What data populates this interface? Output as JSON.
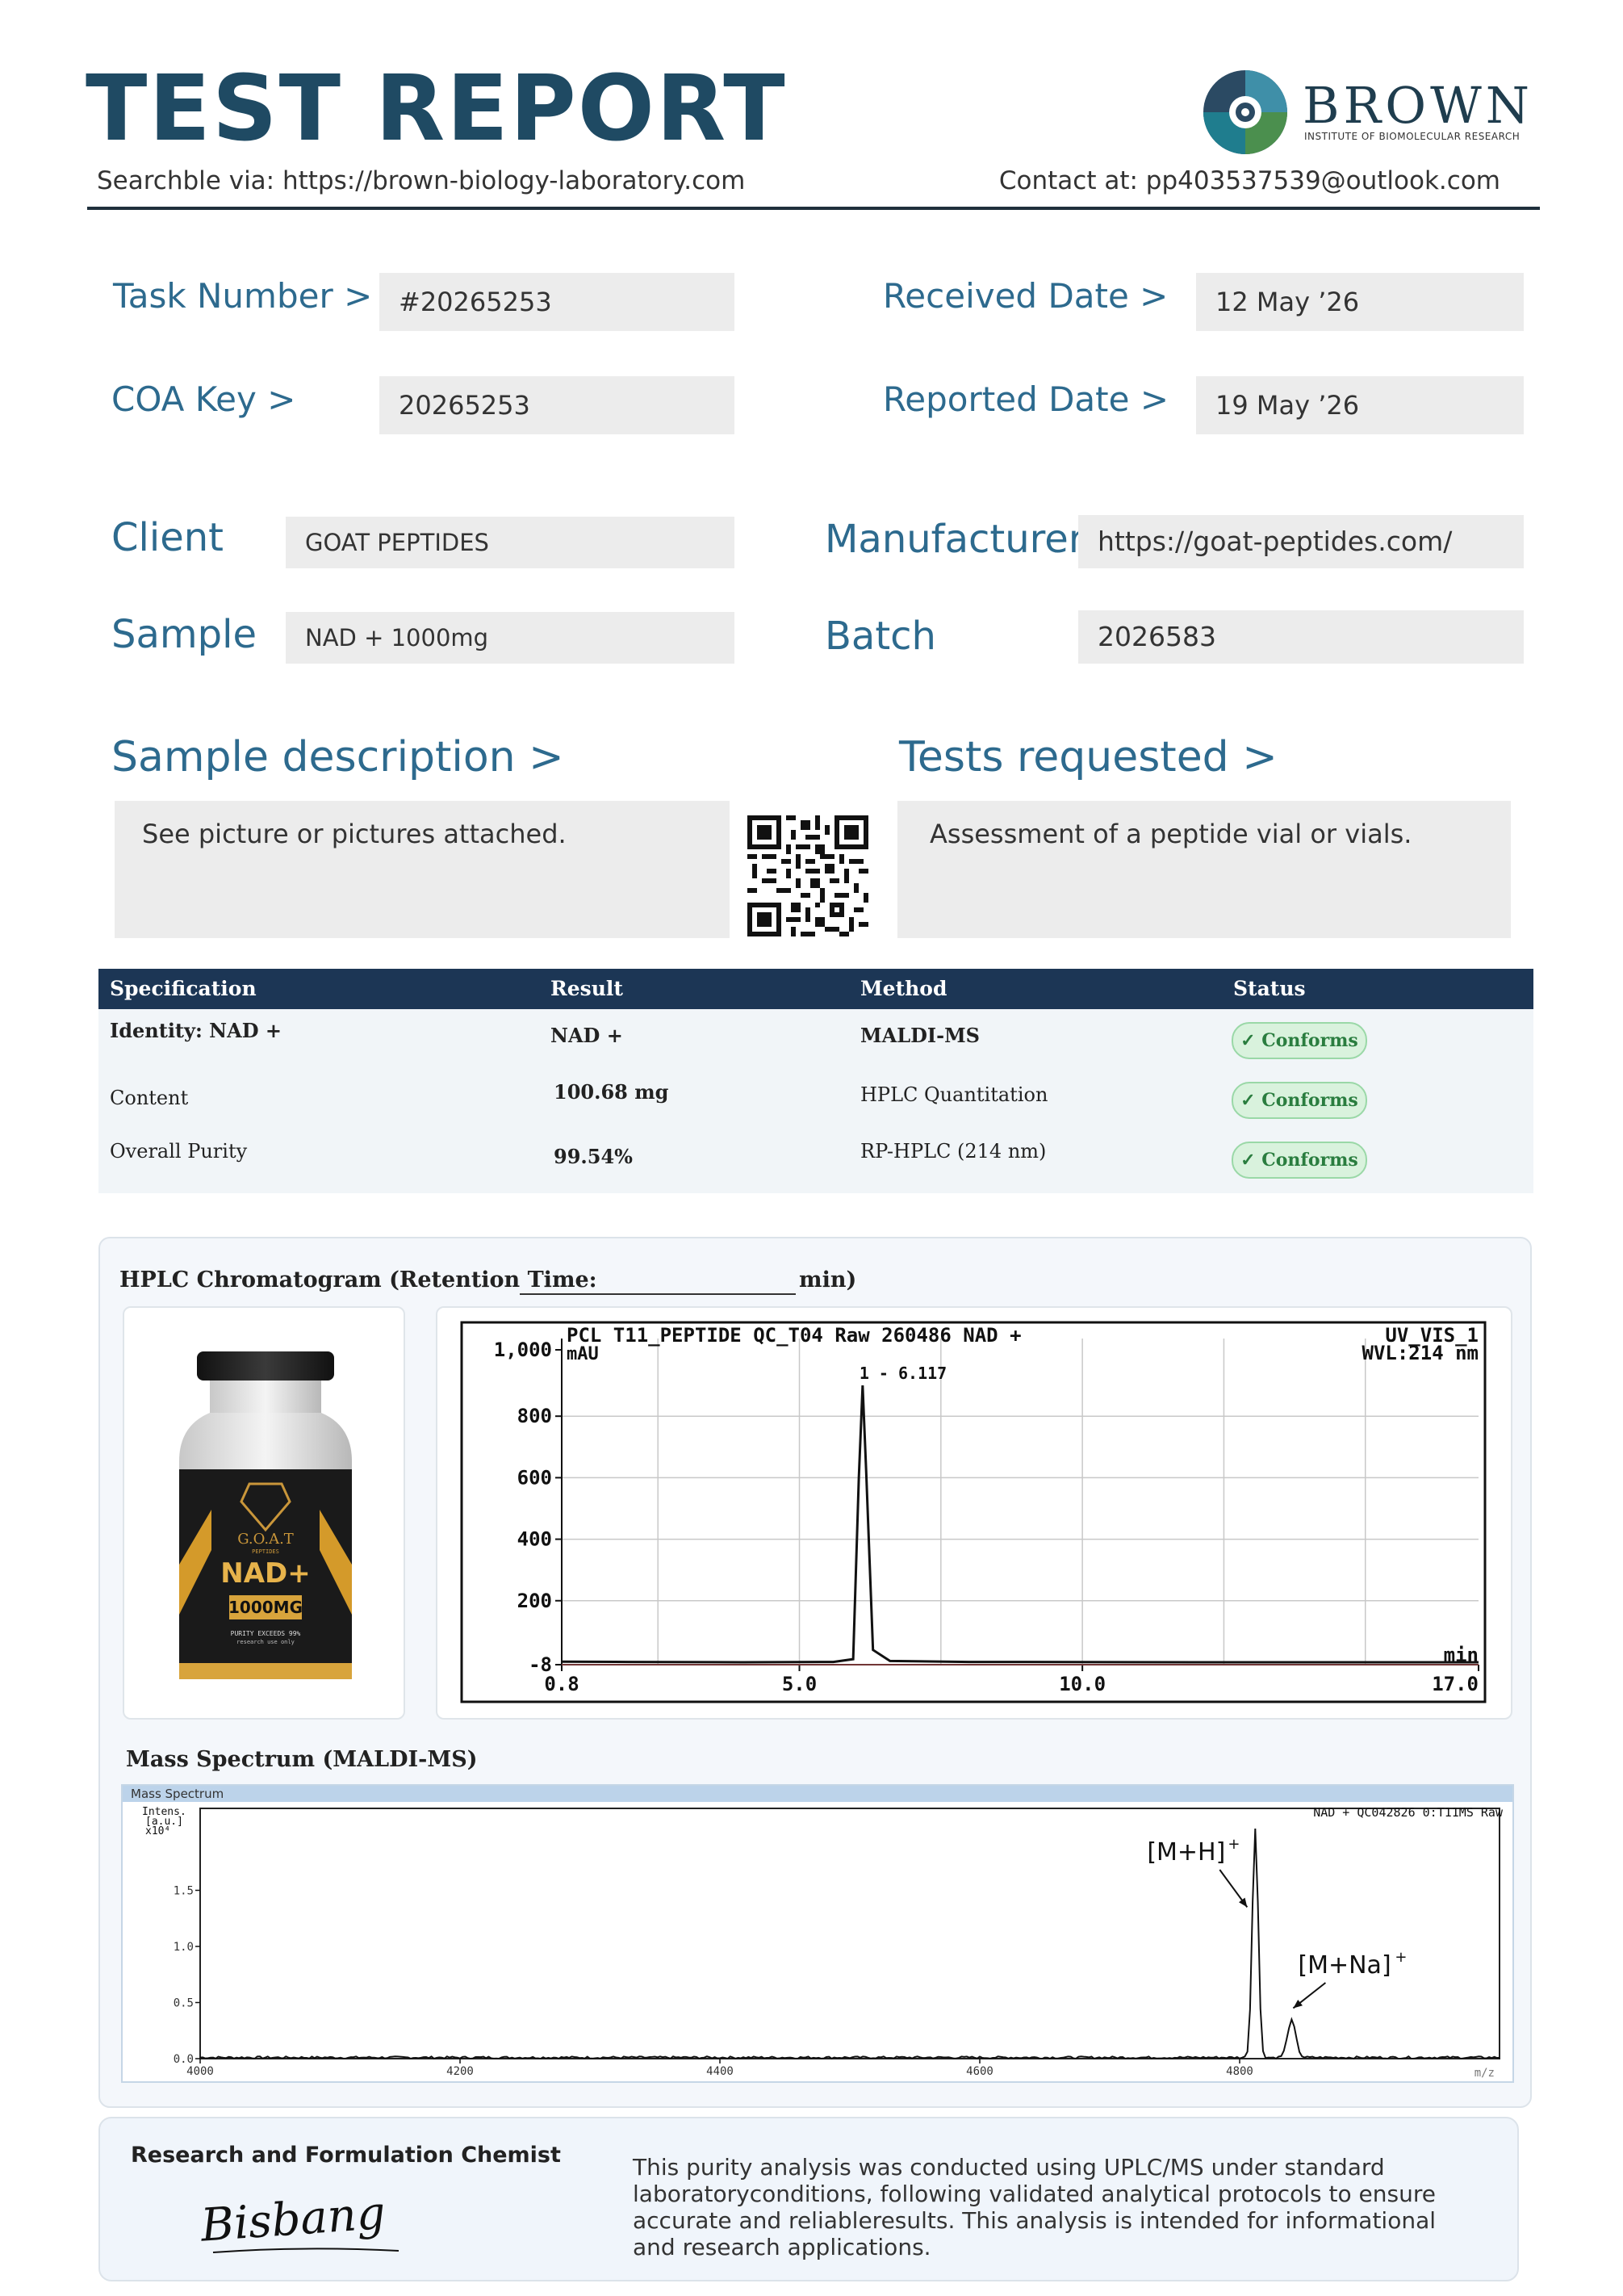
{
  "header": {
    "title": "TEST REPORT",
    "search_line": "Searchble via: https://brown-biology-laboratory.com",
    "contact_line": "Contact at: pp403537539@outlook.com",
    "logo_word": "BROWN",
    "logo_sub": "INSTITUTE OF BIOMOLECULAR RESEARCH"
  },
  "info": {
    "task_label": "Task Number  >",
    "task_value": "#20265253",
    "coa_label": "COA  Key >",
    "coa_value": "20265253",
    "received_label": "Received Date  >",
    "received_value": "12 May ’26",
    "reported_label": "Reported Date >",
    "reported_value": "19 May ’26",
    "client_label": "Client",
    "client_value": "GOAT PEPTIDES",
    "manufacturer_label": "Manufacturer",
    "manufacturer_value": "https://goat-peptides.com/",
    "sample_label": "Sample",
    "sample_value": "NAD + 1000mg",
    "batch_label": "Batch",
    "batch_value": "2026583"
  },
  "description": {
    "sample_desc_label": "Sample description   >",
    "sample_desc_text": "See picture or pictures attached.",
    "tests_label": "Tests requested   >",
    "tests_text": "Assessment of a peptide vial or vials."
  },
  "spec_table": {
    "headers": [
      "Specification",
      "Result",
      "Method",
      "Status"
    ],
    "rows": [
      {
        "spec": "Identity: NAD +",
        "result": "NAD +",
        "method": "MALDI-MS",
        "status": "✓ Conforms"
      },
      {
        "spec": "Content",
        "result": "100.68 mg",
        "method": "HPLC Quantitation",
        "status": "✓ Conforms"
      },
      {
        "spec": "Overall Purity",
        "result": "99.54%",
        "method": "RP-HPLC (214 nm)",
        "status": "✓ Conforms"
      }
    ]
  },
  "charts": {
    "hplc_title": "HPLC Chromatogram (Retention Time:",
    "hplc_title_suffix": "min)",
    "ms_title": "Mass Spectrum (MALDI-MS)",
    "ms_card_title": "Mass Spectrum"
  },
  "vial": {
    "brand": "G.O.A.T",
    "brand_sub": "PEPTIDES",
    "product": "NAD+",
    "dose": "1000MG",
    "note": "PURITY EXCEEDS 99%",
    "note2": "research use only"
  },
  "chart_data": [
    {
      "type": "line",
      "title": "PCL T11_PEPTIDE QC_T04 Raw 260486 NAD +",
      "channel": "UV_VIS_1",
      "wavelength": "WVL:214 nm",
      "ylabel": "mAU",
      "xlabel": "min",
      "ylim": [
        -8,
        1000
      ],
      "xlim": [
        0.8,
        17.0
      ],
      "y_ticks": [
        "1,000",
        "800",
        "600",
        "400",
        "200",
        "-8"
      ],
      "x_ticks": [
        "0.8",
        "5.0",
        "10.0",
        "17.0"
      ],
      "y_tick_values": [
        1000,
        800,
        600,
        400,
        200,
        -8
      ],
      "x_tick_values": [
        0.8,
        5.0,
        10.0,
        17.0
      ],
      "peak_label": "1 - 6.117",
      "peak": {
        "x": 6.117,
        "y": 900
      },
      "x": [
        0.8,
        2.0,
        4.0,
        5.6,
        5.95,
        6.05,
        6.117,
        6.18,
        6.3,
        6.6,
        8.0,
        12.0,
        17.0
      ],
      "y": [
        2,
        1,
        0,
        1,
        10,
        600,
        900,
        620,
        40,
        4,
        1,
        0,
        0
      ],
      "grid": true
    },
    {
      "type": "line",
      "annotation_top": "NAD + QC042826 0:T11MS Raw",
      "ylabel_lines": [
        "Intens.",
        "[a.u.]",
        "x10⁴"
      ],
      "xlabel": "m/z",
      "xlim": [
        4000,
        5000
      ],
      "ylim": [
        0,
        2.0
      ],
      "x_ticks": [
        "4000",
        "4200",
        "4400",
        "4600",
        "4800"
      ],
      "x_tick_values": [
        4000,
        4200,
        4400,
        4600,
        4800
      ],
      "y_ticks": [
        "1.5",
        "1.0",
        "0.5",
        "0.0"
      ],
      "y_tick_values": [
        1.5,
        1.0,
        0.5,
        0.0
      ],
      "peaks": [
        {
          "label": "[M+H]",
          "sup": "+",
          "x": 4812,
          "y": 2.05
        },
        {
          "label": "[M+Na]",
          "sup": "+",
          "x": 4840,
          "y": 0.33
        }
      ],
      "grid": false
    }
  ],
  "footer": {
    "chemist_label": "Research and Formulation Chemist",
    "signature": "Bisbang",
    "disclaimer": "This purity analysis was conducted using UPLC/MS under standard laboratoryconditions, following validated analytical protocols to ensure accurate and reliableresults. This analysis is intended for informational and research applications."
  }
}
